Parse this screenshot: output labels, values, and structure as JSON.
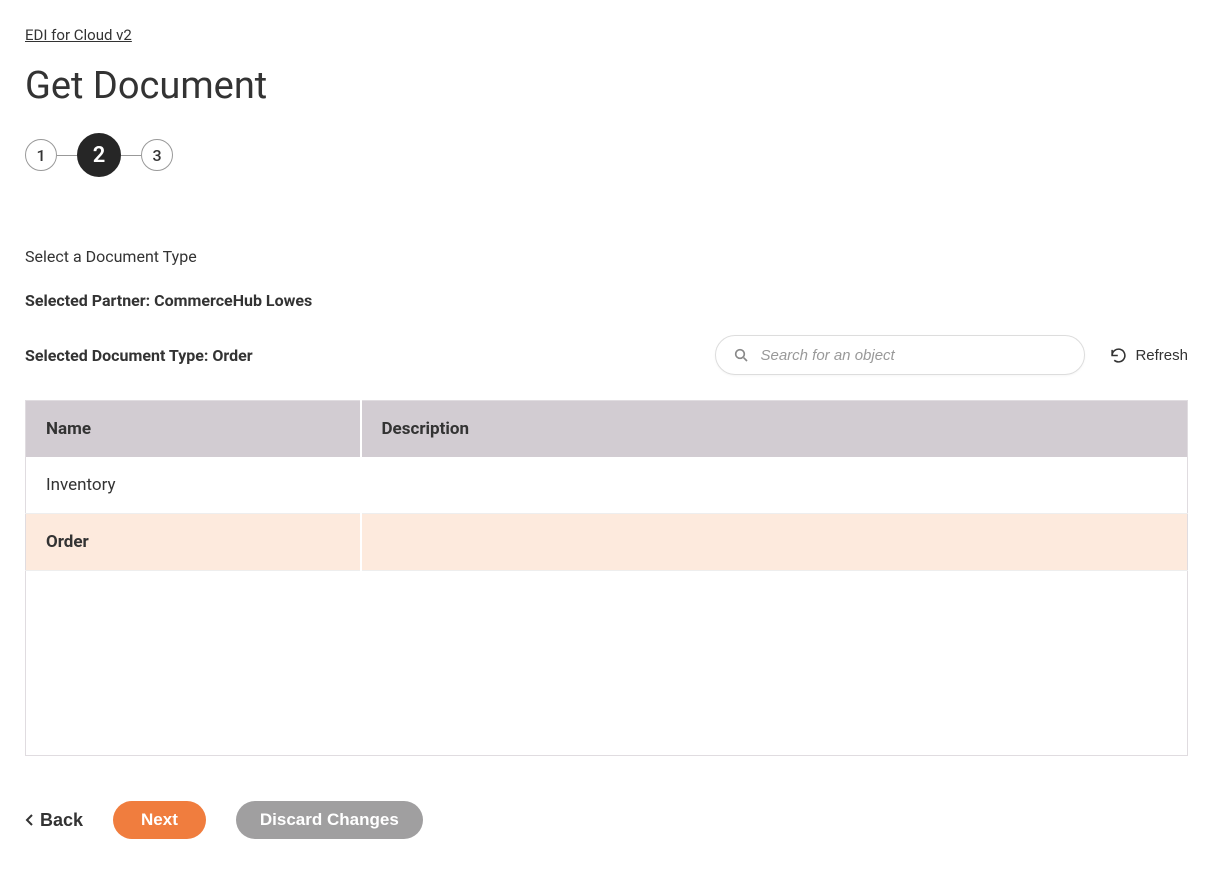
{
  "breadcrumb": "EDI for Cloud v2",
  "page_title": "Get Document",
  "stepper": {
    "steps": [
      "1",
      "2",
      "3"
    ],
    "active_index": 1
  },
  "section_label": "Select a Document Type",
  "selected_partner_label": "Selected Partner: CommerceHub Lowes",
  "selected_doc_type_label": "Selected Document Type: Order",
  "search": {
    "placeholder": "Search for an object"
  },
  "refresh_label": "Refresh",
  "table": {
    "columns": [
      "Name",
      "Description"
    ],
    "rows": [
      {
        "name": "Inventory",
        "description": "",
        "selected": false
      },
      {
        "name": "Order",
        "description": "",
        "selected": true
      }
    ]
  },
  "footer": {
    "back": "Back",
    "next": "Next",
    "discard": "Discard Changes"
  }
}
